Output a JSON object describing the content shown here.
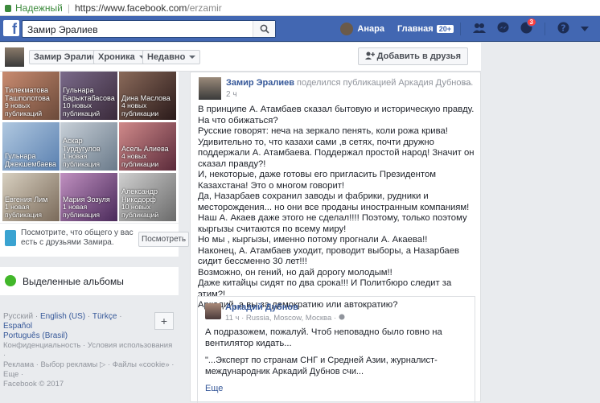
{
  "browser": {
    "secure_label": "Надежный",
    "url_host": "https://www.facebook.com",
    "url_path": "/erzamir"
  },
  "topbar": {
    "search_value": "Замир Эралиев",
    "user_name": "Анара",
    "home_label": "Главная",
    "home_badge": "20+",
    "notif_badge": "3"
  },
  "profile_bar": {
    "name_button": "Замир Эралиев",
    "timeline_button": "Хроника",
    "recent_button": "Недавно",
    "add_friend": "Добавить в друзья"
  },
  "friends": [
    {
      "name": "Тилекматова Ташполотова",
      "count": "9 новых публикаций"
    },
    {
      "name": "Гульнара Барыктабасова",
      "count": "10 новых публикаций"
    },
    {
      "name": "Дина Маслова",
      "count": "4 новых публикации"
    },
    {
      "name": "Гульнара Джекшембаева",
      "count": ""
    },
    {
      "name": "Аскар Турдугулов",
      "count": "1 новая публикация"
    },
    {
      "name": "Асель Алиева",
      "count": "4 новых публикации"
    },
    {
      "name": "Евгения Лим",
      "count": "1 новая публикация"
    },
    {
      "name": "Мария Зозуля",
      "count": "1 новая публикация"
    },
    {
      "name": "Александр Никсдорф",
      "count": "10 новых публикаций"
    }
  ],
  "friends_note": {
    "text": "Посмотрите, что общего у вас есть с друзьями Замира.",
    "button": "Посмотреть"
  },
  "albums": {
    "label": "Выделенные альбомы"
  },
  "languages": {
    "current": "Русский",
    "l1": "English (US)",
    "l2": "Türkçe",
    "l3": "Español",
    "l4": "Português (Brasil)",
    "plus": "+"
  },
  "footer": {
    "line1": "Конфиденциальность · Условия использования ·",
    "line2": "Реклама · Выбор рекламы ▷ · Файлы «cookie» ·",
    "line3": "Еще ·",
    "line4": "Facebook © 2017"
  },
  "post": {
    "author": "Замир Эралиев",
    "shared": "поделился публикацией Аркадия Дубнова.",
    "time": "2 ч",
    "more": "···",
    "lines": [
      "В принципе А. Атамбаев сказал бытовую и историческую правду. На что обижаться?",
      "Русские говорят: неча на зеркало пенять, коли рожа крива! Удивительно то, что казахи сами ,в сетях, почти дружно поддержали А. Атамбаева. Поддержал простой народ! Значит он сказал правду?!",
      "И, некоторые, даже готовы его пригласить Президентом Казахстана! Это о многом говорит!",
      "Да, Назарбаев сохранил заводы и фабрики, рудники и месторождения... но они все проданы иностранным компаниям!",
      "Наш А. Акаев даже этого не сделал!!!! Поэтому, только поэтому кыргызы считаются по всему миру!",
      "Но мы , кыргызы, именно потому прогнали А. Акаева!!",
      "Наконец, А. Атамбаев уходит, проводит выборы, а Назарбаев сидит бессменно 30 лет!!!",
      "Возможно, он гений, но дай дорогу молодым!!",
      "Даже китайцы сидят по два срока!!! И Политбюро следит за этим?!",
      "Аркадий, а вы за демократию или автократию?"
    ],
    "shared_post": {
      "author": "Аркадий Дубнов",
      "meta": "11 ч · Russia, Moscow, Москва · ",
      "text": "А подразожем, пожалуй. Чтоб неповадно было говно на вентилятор кидать...",
      "snippet": "\"...Эксперт по странам СНГ и Средней Азии, журналист-международник Аркадий Дубнов счи...",
      "more": "Еще"
    }
  }
}
